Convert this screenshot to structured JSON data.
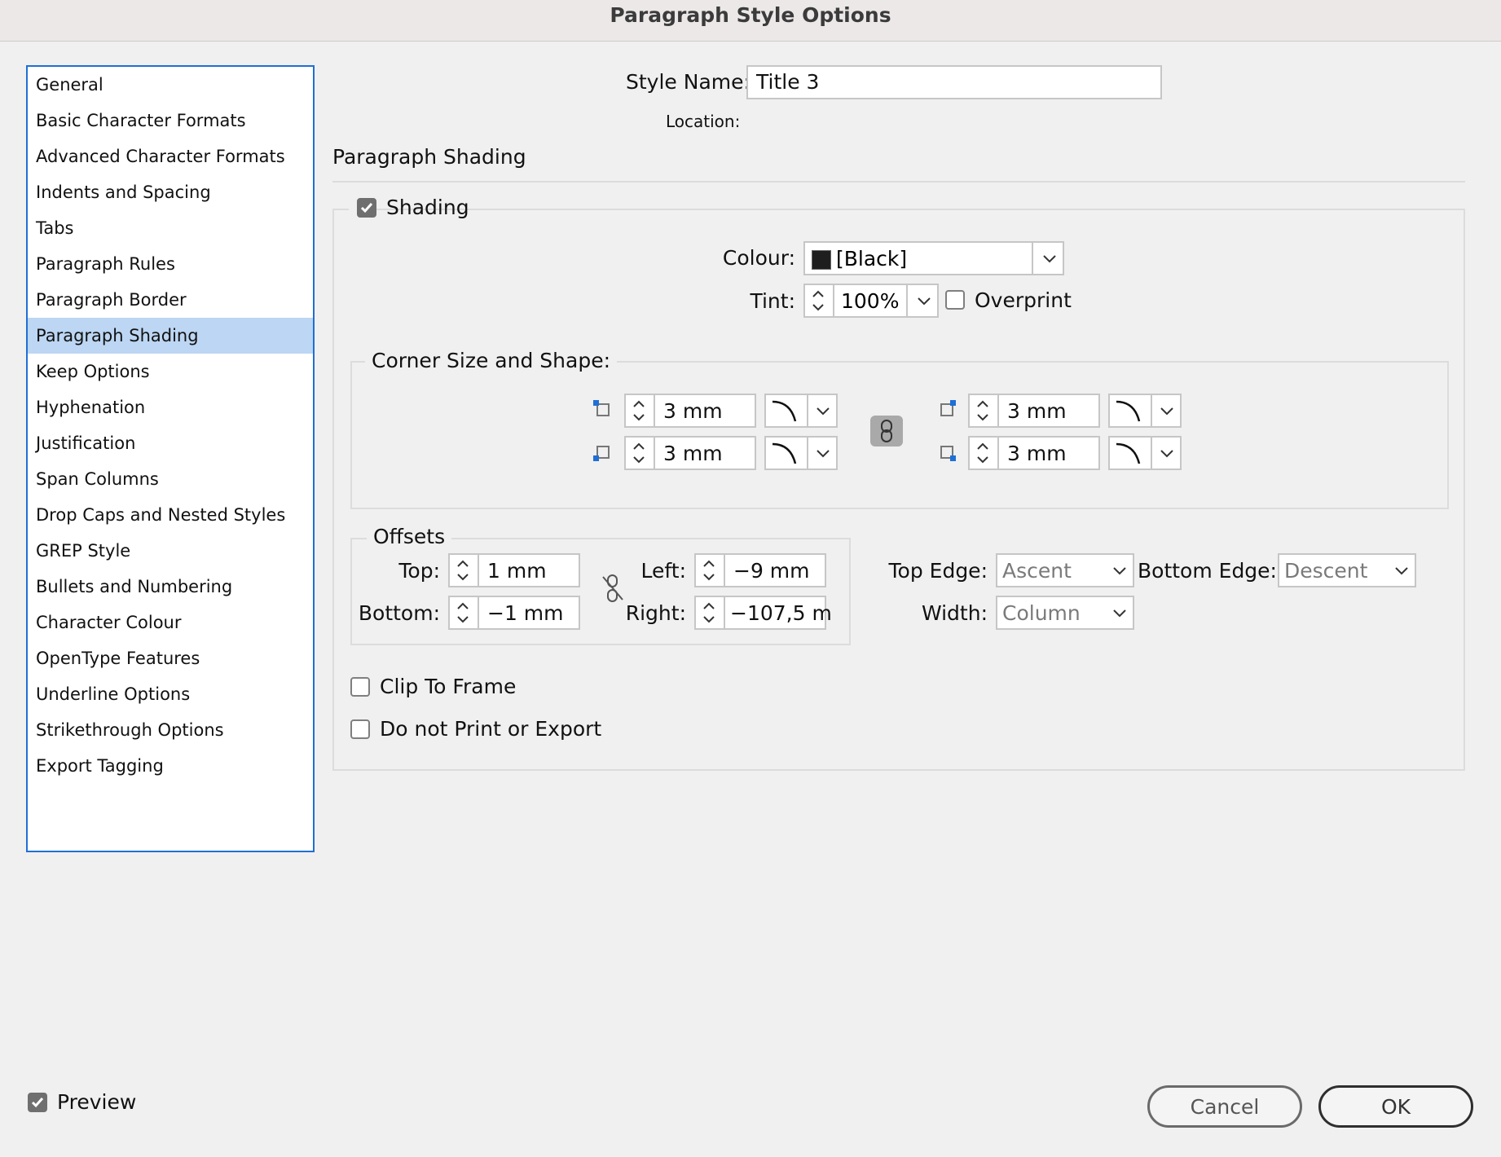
{
  "window": {
    "title": "Paragraph Style Options"
  },
  "sidebar": {
    "selected": "Paragraph Shading",
    "items": [
      "General",
      "Basic Character Formats",
      "Advanced Character Formats",
      "Indents and Spacing",
      "Tabs",
      "Paragraph Rules",
      "Paragraph Border",
      "Paragraph Shading",
      "Keep Options",
      "Hyphenation",
      "Justification",
      "Span Columns",
      "Drop Caps and Nested Styles",
      "GREP Style",
      "Bullets and Numbering",
      "Character Colour",
      "OpenType Features",
      "Underline Options",
      "Strikethrough Options",
      "Export Tagging"
    ]
  },
  "header": {
    "style_name_label": "Style Name:",
    "style_name_value": "Title 3",
    "location_label": "Location:"
  },
  "section": {
    "title": "Paragraph Shading"
  },
  "shading": {
    "checkbox_label": "Shading",
    "checked": true,
    "colour_label": "Colour:",
    "colour_value": "[Black]",
    "colour_swatch": "#1e1e1e",
    "tint_label": "Tint:",
    "tint_value": "100%",
    "overprint_label": "Overprint",
    "overprint_checked": false
  },
  "corners": {
    "title": "Corner Size and Shape:",
    "top_left": "3 mm",
    "bottom_left": "3 mm",
    "top_right": "3 mm",
    "bottom_right": "3 mm",
    "linked": true
  },
  "offsets": {
    "title": "Offsets",
    "top_label": "Top:",
    "top_value": "1 mm",
    "bottom_label": "Bottom:",
    "bottom_value": "−1 mm",
    "left_label": "Left:",
    "left_value": "−9 mm",
    "right_label": "Right:",
    "right_value": "−107,5 m",
    "linked": false
  },
  "edges": {
    "top_edge_label": "Top Edge:",
    "top_edge_value": "Ascent",
    "bottom_edge_label": "Bottom Edge:",
    "bottom_edge_value": "Descent",
    "width_label": "Width:",
    "width_value": "Column"
  },
  "options": {
    "clip_label": "Clip To Frame",
    "clip_checked": false,
    "noprint_label": "Do not Print or Export",
    "noprint_checked": false
  },
  "footer": {
    "preview_label": "Preview",
    "preview_checked": true,
    "cancel_label": "Cancel",
    "ok_label": "OK"
  },
  "colors": {
    "accent": "#1f6fd6",
    "selection": "#bcd6f3",
    "corner_marker": "#1f6fd6"
  }
}
